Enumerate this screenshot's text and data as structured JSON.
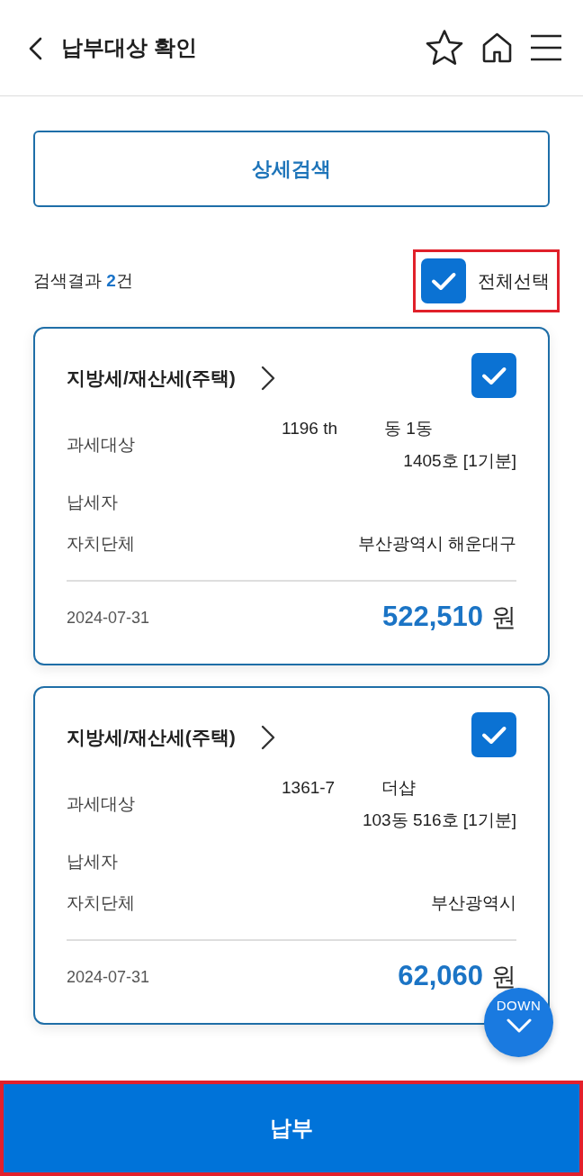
{
  "header": {
    "title": "납부대상 확인"
  },
  "detail_search_button": {
    "label": "상세검색"
  },
  "results": {
    "text": "검색결과 **2**건"
  },
  "select_all": {
    "label": "전체선택",
    "checked": true,
    "highlighted": true
  },
  "bills": [
    {
      "title": "지방세/재산세(주택)",
      "checked": true,
      "fields": [
        {
          "label": "과세대상",
          "lines": [
            {
              "parts": [
                "1196 th",
                "동 1동"
              ]
            },
            {
              "parts": [
                "1405호 [1기분]"
              ]
            }
          ]
        },
        {
          "label": "납세자"
        },
        {
          "label": "자치단체",
          "lines": [
            {
              "parts": [
                "부산광역시 해운대구"
              ]
            }
          ]
        }
      ],
      "due_date": "2024-07-31",
      "amount": "522,510",
      "currency": "원"
    },
    {
      "title": "지방세/재산세(주택)",
      "checked": true,
      "fields": [
        {
          "label": "과세대상",
          "lines": [
            {
              "parts": [
                "1361-7",
                "더샵"
              ]
            },
            {
              "parts": [
                "103동 516호 [1기분]"
              ]
            }
          ]
        },
        {
          "label": "납세자"
        },
        {
          "label": "자치단체",
          "lines": [
            {
              "parts": [
                "부산광역시"
              ]
            }
          ]
        }
      ],
      "due_date": "2024-07-31",
      "amount": "62,060",
      "currency": "원"
    }
  ],
  "scroll_down_button": {
    "label": "DOWN"
  },
  "pay_button": {
    "label": "납부",
    "highlighted": true
  }
}
